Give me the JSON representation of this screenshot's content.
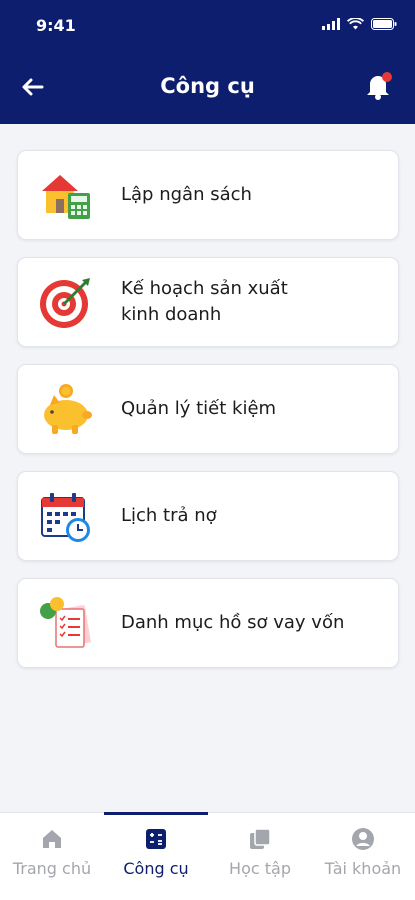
{
  "status": {
    "time": "9:41"
  },
  "header": {
    "title": "Công cụ"
  },
  "tools": [
    {
      "label": "Lập ngân sách",
      "icon": "house-calculator-icon"
    },
    {
      "label": "Kế hoạch sản xuất\nkinh doanh",
      "icon": "target-arrow-icon"
    },
    {
      "label": "Quản lý tiết kiệm",
      "icon": "piggy-bank-icon"
    },
    {
      "label": "Lịch trả nợ",
      "icon": "calendar-clock-icon"
    },
    {
      "label": "Danh mục hồ sơ vay vốn",
      "icon": "documents-checklist-icon"
    }
  ],
  "tabs": [
    {
      "label": "Trang chủ",
      "icon": "home-icon",
      "active": false
    },
    {
      "label": "Công cụ",
      "icon": "tools-icon",
      "active": true
    },
    {
      "label": "Học tập",
      "icon": "book-icon",
      "active": false
    },
    {
      "label": "Tài khoản",
      "icon": "account-icon",
      "active": false
    }
  ],
  "colors": {
    "primary": "#0d1e6e",
    "background": "#f3f4f8",
    "inactive_tab": "#a3a6ad",
    "notification_dot": "#e53935"
  }
}
